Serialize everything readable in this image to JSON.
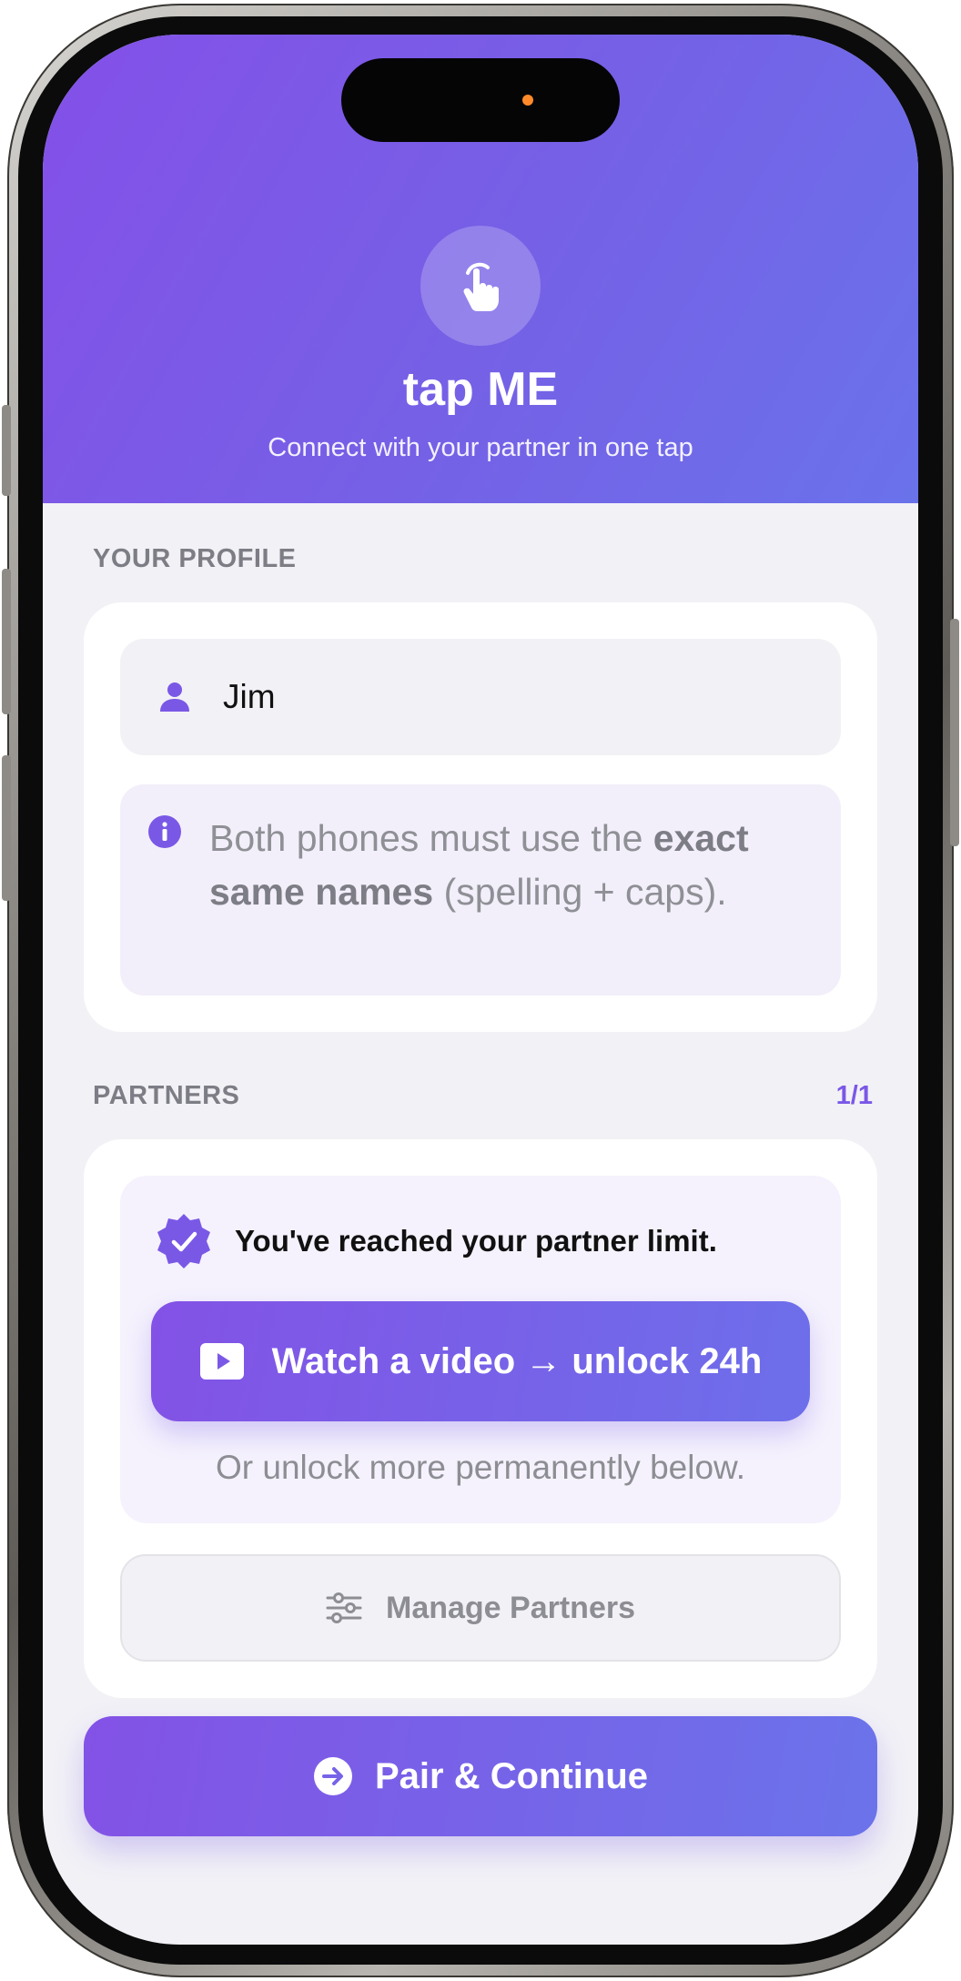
{
  "app": {
    "title": "tap ME",
    "subtitle": "Connect with your partner in one tap",
    "logo_icon": "hand-tap-icon"
  },
  "profile": {
    "section_label": "YOUR PROFILE",
    "name_value": "Jim",
    "name_icon": "person-icon",
    "info_icon": "info-icon",
    "info_text_before": "Both phones must use the ",
    "info_text_bold": "exact same names",
    "info_text_after": " (spelling + caps)."
  },
  "partners": {
    "section_label": "PARTNERS",
    "count": "1/1",
    "limit_icon": "verified-badge-icon",
    "limit_message": "You've reached your partner limit.",
    "watch_button_label": "Watch a video → unlock 24h",
    "watch_icon": "play-icon",
    "unlock_hint": "Or unlock more permanently below.",
    "manage_button_label": "Manage Partners",
    "manage_icon": "sliders-icon"
  },
  "footer": {
    "pair_button_label": "Pair & Continue",
    "pair_icon": "arrow-right-circle-icon"
  },
  "colors": {
    "accent": "#7a58e6",
    "gradient_start": "#8450e8",
    "gradient_end": "#6a72ea",
    "background": "#f2f1f6"
  }
}
